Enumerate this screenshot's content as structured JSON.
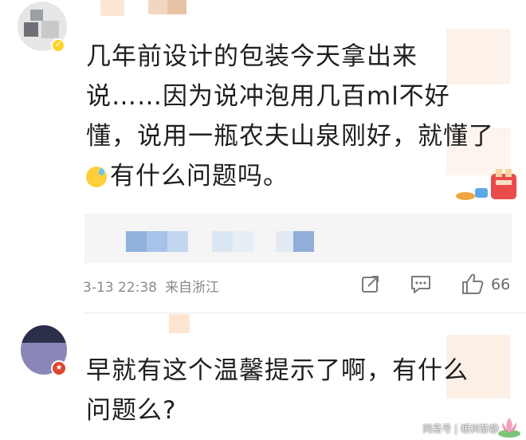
{
  "comments": [
    {
      "lines": [
        "几年前设计的包装今天拿出来",
        "说……因为说冲泡用几百ml不好",
        "懂，说用一瓶农夫山泉刚好，就懂了",
        "有什么问题吗。"
      ],
      "emoji_icon": "sweat-emoji",
      "timestamp": "3-13 22:38",
      "location": "来自浙江",
      "likes": "66"
    },
    {
      "lines": [
        "早就有这个温馨提示了啊，有什么",
        "问题么?"
      ]
    }
  ],
  "watermark": {
    "text": "网易号 | 暖树静静"
  },
  "icons": {
    "share": "share-icon",
    "comment": "comment-icon",
    "like": "thumbs-up-icon"
  }
}
